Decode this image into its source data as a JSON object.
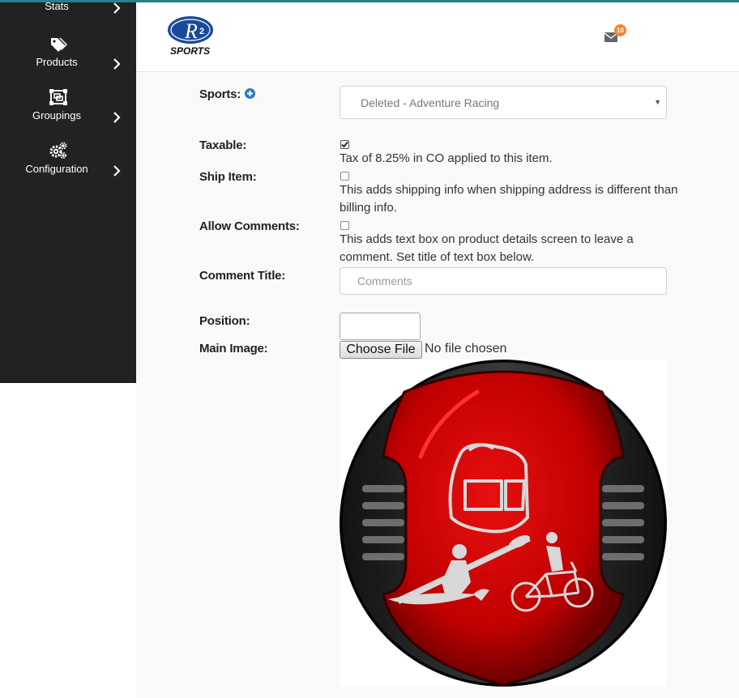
{
  "sidebar": {
    "items": [
      {
        "label": "Stats",
        "icon": "stats-icon"
      },
      {
        "label": "Products",
        "icon": "tags-icon"
      },
      {
        "label": "Groupings",
        "icon": "object-group-icon"
      },
      {
        "label": "Configuration",
        "icon": "cogs-icon"
      }
    ]
  },
  "header": {
    "logo_letter": "R",
    "logo_sup": "2",
    "logo_sub": "SPORTS",
    "mail_count": "10"
  },
  "form": {
    "sports_label": "Sports:",
    "sports_value": "Deleted - Adventure Racing",
    "taxable_label": "Taxable:",
    "taxable_checked": true,
    "taxable_help": "Tax of 8.25% in CO applied to this item.",
    "ship_label": "Ship Item:",
    "ship_checked": false,
    "ship_help": "This adds shipping info when shipping address is different than billing info.",
    "comments_label": "Allow Comments:",
    "comments_checked": false,
    "comments_help": "This adds text box on product details screen to leave a comment. Set title of text box below.",
    "comment_title_label": "Comment Title:",
    "comment_title_placeholder": "Comments",
    "position_label": "Position:",
    "main_image_label": "Main Image:",
    "file_button": "Choose File",
    "file_status": "No file chosen"
  },
  "colors": {
    "sidebar_bg": "#222222",
    "badge": "#f0872c",
    "accent_blue": "#2f78c4",
    "helmet_red": "#c40000"
  }
}
